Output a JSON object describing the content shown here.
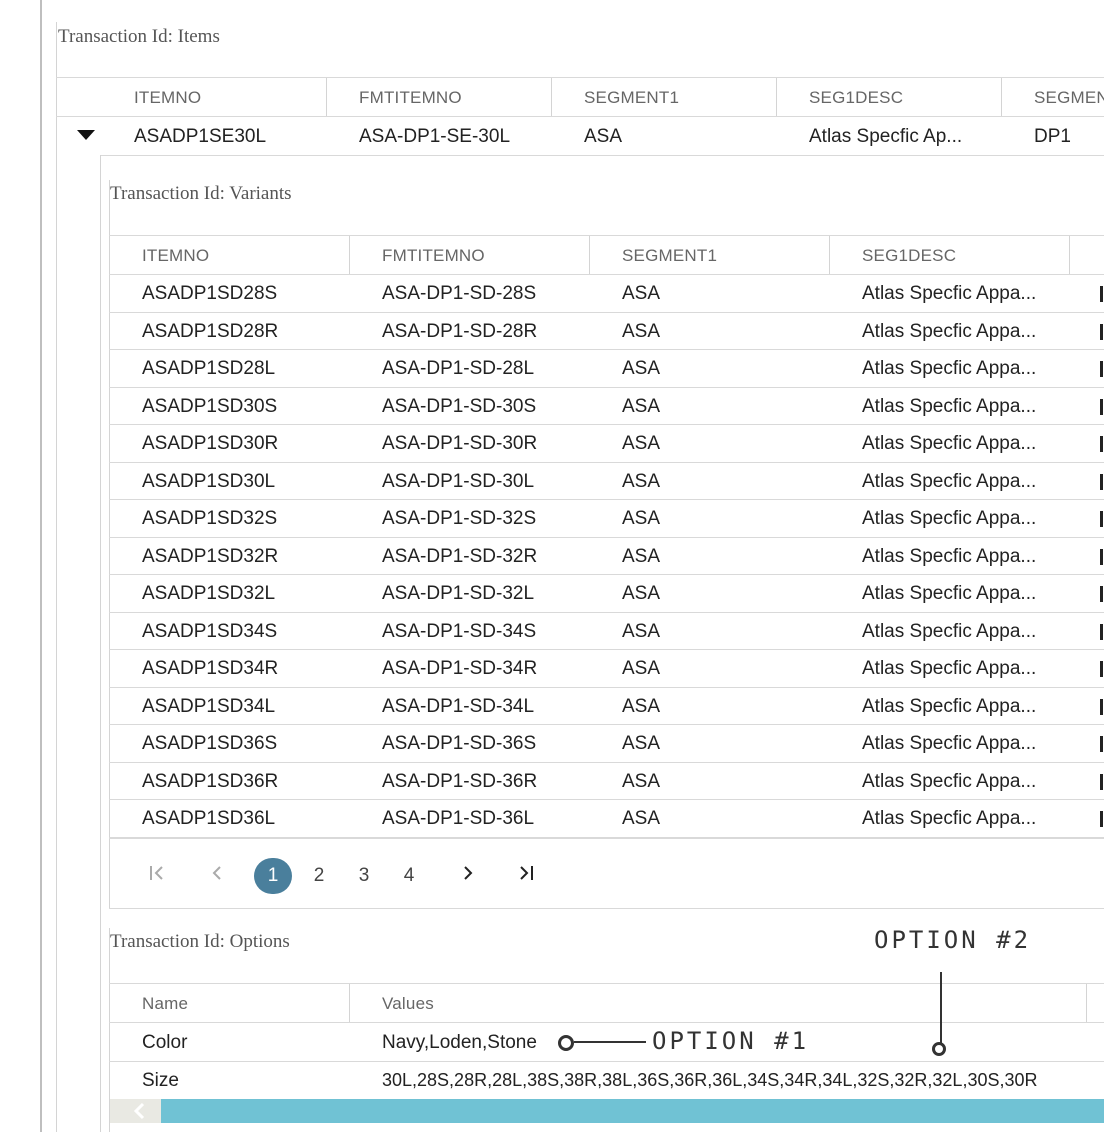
{
  "items": {
    "title": "Transaction Id: Items",
    "columns": [
      "ITEMNO",
      "FMTITEMNO",
      "SEGMENT1",
      "SEG1DESC",
      "SEGMEN"
    ],
    "row": [
      "ASADP1SE30L",
      "ASA-DP1-SE-30L",
      "ASA",
      "Atlas Specfic Ap...",
      "DP1"
    ]
  },
  "variants": {
    "title": "Transaction Id: Variants",
    "columns": [
      "ITEMNO",
      "FMTITEMNO",
      "SEGMENT1",
      "SEG1DESC"
    ],
    "rows": [
      [
        "ASADP1SD28S",
        "ASA-DP1-SD-28S",
        "ASA",
        "Atlas Specfic Appa..."
      ],
      [
        "ASADP1SD28R",
        "ASA-DP1-SD-28R",
        "ASA",
        "Atlas Specfic Appa..."
      ],
      [
        "ASADP1SD28L",
        "ASA-DP1-SD-28L",
        "ASA",
        "Atlas Specfic Appa..."
      ],
      [
        "ASADP1SD30S",
        "ASA-DP1-SD-30S",
        "ASA",
        "Atlas Specfic Appa..."
      ],
      [
        "ASADP1SD30R",
        "ASA-DP1-SD-30R",
        "ASA",
        "Atlas Specfic Appa..."
      ],
      [
        "ASADP1SD30L",
        "ASA-DP1-SD-30L",
        "ASA",
        "Atlas Specfic Appa..."
      ],
      [
        "ASADP1SD32S",
        "ASA-DP1-SD-32S",
        "ASA",
        "Atlas Specfic Appa..."
      ],
      [
        "ASADP1SD32R",
        "ASA-DP1-SD-32R",
        "ASA",
        "Atlas Specfic Appa..."
      ],
      [
        "ASADP1SD32L",
        "ASA-DP1-SD-32L",
        "ASA",
        "Atlas Specfic Appa..."
      ],
      [
        "ASADP1SD34S",
        "ASA-DP1-SD-34S",
        "ASA",
        "Atlas Specfic Appa..."
      ],
      [
        "ASADP1SD34R",
        "ASA-DP1-SD-34R",
        "ASA",
        "Atlas Specfic Appa..."
      ],
      [
        "ASADP1SD34L",
        "ASA-DP1-SD-34L",
        "ASA",
        "Atlas Specfic Appa..."
      ],
      [
        "ASADP1SD36S",
        "ASA-DP1-SD-36S",
        "ASA",
        "Atlas Specfic Appa..."
      ],
      [
        "ASADP1SD36R",
        "ASA-DP1-SD-36R",
        "ASA",
        "Atlas Specfic Appa..."
      ],
      [
        "ASADP1SD36L",
        "ASA-DP1-SD-36L",
        "ASA",
        "Atlas Specfic Appa..."
      ]
    ],
    "pager": {
      "first_icon": "first-page-icon",
      "prev_icon": "prev-page-icon",
      "pages": [
        "1",
        "2",
        "3",
        "4"
      ],
      "current": "1",
      "next_icon": "next-page-icon",
      "last_icon": "last-page-icon"
    }
  },
  "options": {
    "title": "Transaction Id: Options",
    "columns": [
      "Name",
      "Values"
    ],
    "rows": [
      [
        "Color",
        "Navy,Loden,Stone"
      ],
      [
        "Size",
        "30L,28S,28R,28L,38S,38R,38L,36S,36R,36L,34S,34R,34L,32S,32R,32L,30S,30R"
      ]
    ]
  },
  "annotations": {
    "option1": "OPTION #1",
    "option2": "OPTION #2"
  },
  "colors": {
    "accent": "#4a7f9c",
    "scrollbar": "#70c2d4"
  }
}
